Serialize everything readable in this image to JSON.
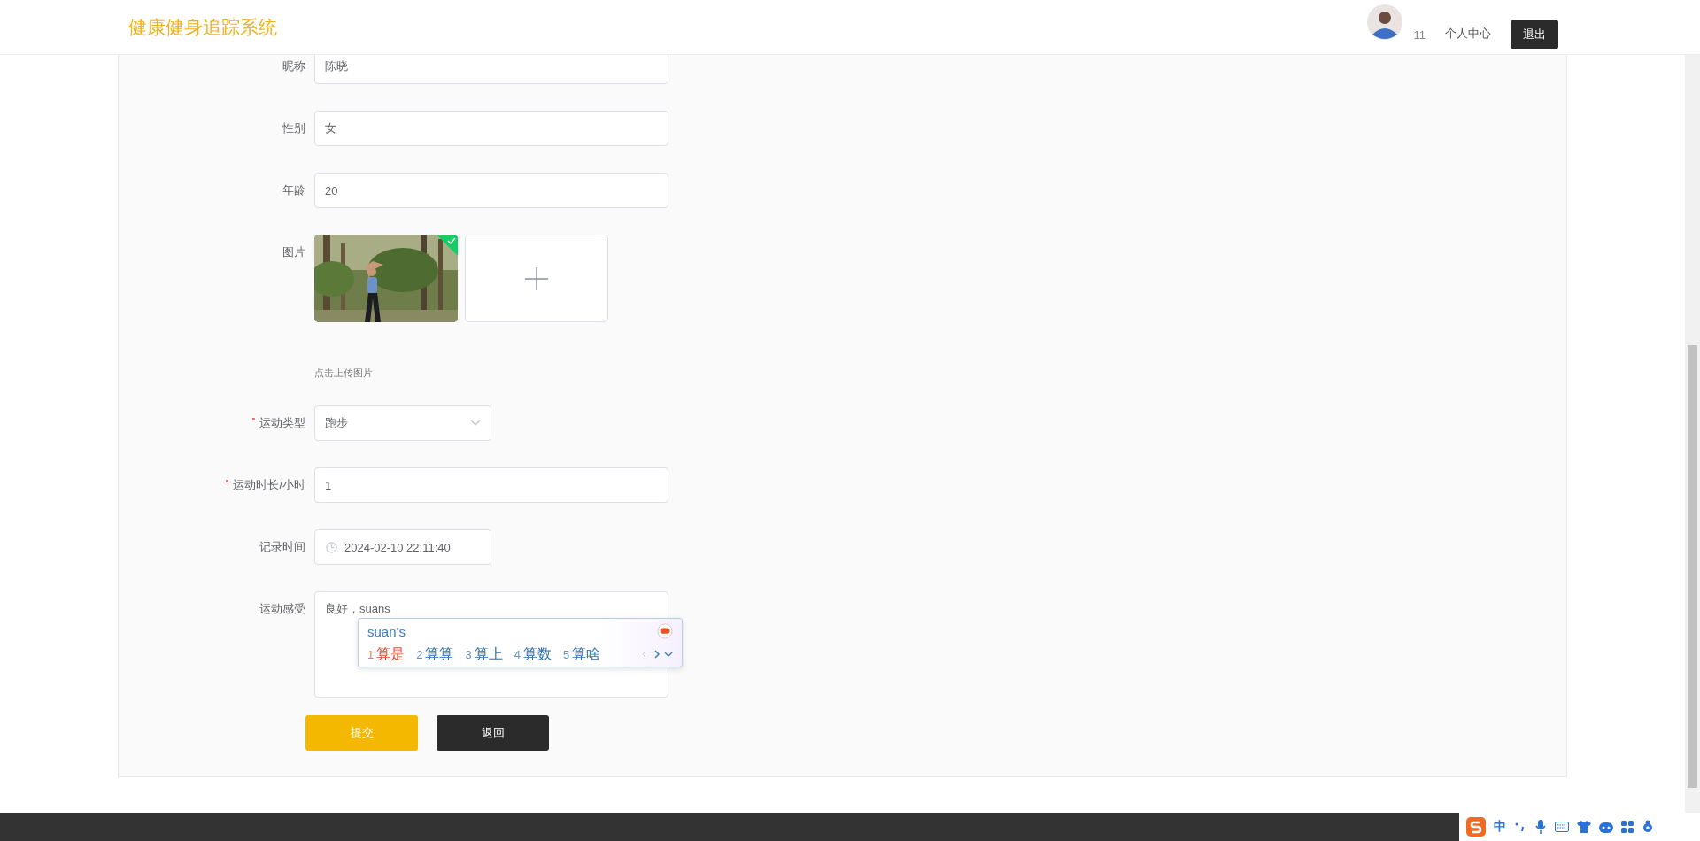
{
  "header": {
    "title": "健康健身追踪系统",
    "user_name": "11",
    "profile_link": "个人中心",
    "logout_button": "退出"
  },
  "form": {
    "rows": [
      {
        "kind": "text",
        "label": "昵称",
        "required": false,
        "value": "陈晓"
      },
      {
        "kind": "text",
        "label": "性别",
        "required": false,
        "value": "女"
      },
      {
        "kind": "text",
        "label": "年龄",
        "required": false,
        "value": "20"
      },
      {
        "kind": "upload",
        "label": "图片",
        "required": false,
        "uploaded": true,
        "hint": "点击上传图片"
      },
      {
        "kind": "select",
        "label": "运动类型",
        "required": true,
        "value": "跑步"
      },
      {
        "kind": "text",
        "label": "运动时长/小时",
        "required": true,
        "value": "1"
      },
      {
        "kind": "datetime",
        "label": "记录时间",
        "required": false,
        "value": "2024-02-10 22:11:40"
      },
      {
        "kind": "textarea",
        "label": "运动感受",
        "required": false,
        "value": "良好，suans"
      }
    ],
    "buttons": [
      {
        "label": "提交",
        "kind": "primary"
      },
      {
        "label": "返回",
        "kind": "dark"
      }
    ]
  },
  "ime_popup": {
    "composition": "suan's",
    "candidates": [
      {
        "index": "1",
        "text": "算是",
        "selected": true
      },
      {
        "index": "2",
        "text": "算算",
        "selected": false
      },
      {
        "index": "3",
        "text": "算上",
        "selected": false
      },
      {
        "index": "4",
        "text": "算数",
        "selected": false
      },
      {
        "index": "5",
        "text": "算啥",
        "selected": false
      }
    ]
  },
  "ime_toolbar": {
    "mode": "中"
  }
}
